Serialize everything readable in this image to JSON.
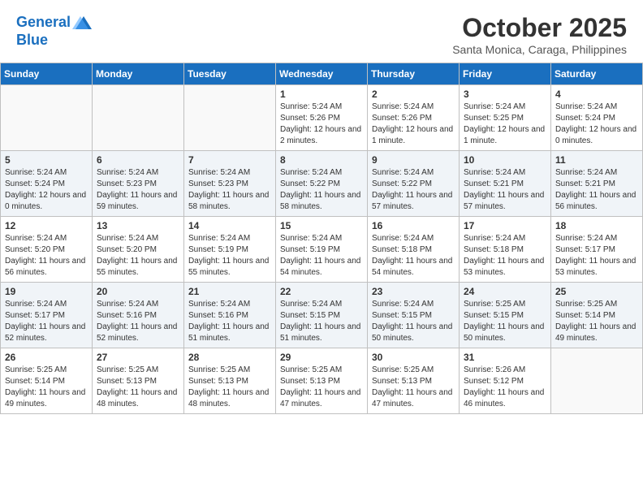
{
  "header": {
    "logo_line1": "General",
    "logo_line2": "Blue",
    "month": "October 2025",
    "location": "Santa Monica, Caraga, Philippines"
  },
  "weekdays": [
    "Sunday",
    "Monday",
    "Tuesday",
    "Wednesday",
    "Thursday",
    "Friday",
    "Saturday"
  ],
  "weeks": [
    [
      {
        "day": "",
        "info": ""
      },
      {
        "day": "",
        "info": ""
      },
      {
        "day": "",
        "info": ""
      },
      {
        "day": "1",
        "info": "Sunrise: 5:24 AM\nSunset: 5:26 PM\nDaylight: 12 hours and 2 minutes."
      },
      {
        "day": "2",
        "info": "Sunrise: 5:24 AM\nSunset: 5:26 PM\nDaylight: 12 hours and 1 minute."
      },
      {
        "day": "3",
        "info": "Sunrise: 5:24 AM\nSunset: 5:25 PM\nDaylight: 12 hours and 1 minute."
      },
      {
        "day": "4",
        "info": "Sunrise: 5:24 AM\nSunset: 5:24 PM\nDaylight: 12 hours and 0 minutes."
      }
    ],
    [
      {
        "day": "5",
        "info": "Sunrise: 5:24 AM\nSunset: 5:24 PM\nDaylight: 12 hours and 0 minutes."
      },
      {
        "day": "6",
        "info": "Sunrise: 5:24 AM\nSunset: 5:23 PM\nDaylight: 11 hours and 59 minutes."
      },
      {
        "day": "7",
        "info": "Sunrise: 5:24 AM\nSunset: 5:23 PM\nDaylight: 11 hours and 58 minutes."
      },
      {
        "day": "8",
        "info": "Sunrise: 5:24 AM\nSunset: 5:22 PM\nDaylight: 11 hours and 58 minutes."
      },
      {
        "day": "9",
        "info": "Sunrise: 5:24 AM\nSunset: 5:22 PM\nDaylight: 11 hours and 57 minutes."
      },
      {
        "day": "10",
        "info": "Sunrise: 5:24 AM\nSunset: 5:21 PM\nDaylight: 11 hours and 57 minutes."
      },
      {
        "day": "11",
        "info": "Sunrise: 5:24 AM\nSunset: 5:21 PM\nDaylight: 11 hours and 56 minutes."
      }
    ],
    [
      {
        "day": "12",
        "info": "Sunrise: 5:24 AM\nSunset: 5:20 PM\nDaylight: 11 hours and 56 minutes."
      },
      {
        "day": "13",
        "info": "Sunrise: 5:24 AM\nSunset: 5:20 PM\nDaylight: 11 hours and 55 minutes."
      },
      {
        "day": "14",
        "info": "Sunrise: 5:24 AM\nSunset: 5:19 PM\nDaylight: 11 hours and 55 minutes."
      },
      {
        "day": "15",
        "info": "Sunrise: 5:24 AM\nSunset: 5:19 PM\nDaylight: 11 hours and 54 minutes."
      },
      {
        "day": "16",
        "info": "Sunrise: 5:24 AM\nSunset: 5:18 PM\nDaylight: 11 hours and 54 minutes."
      },
      {
        "day": "17",
        "info": "Sunrise: 5:24 AM\nSunset: 5:18 PM\nDaylight: 11 hours and 53 minutes."
      },
      {
        "day": "18",
        "info": "Sunrise: 5:24 AM\nSunset: 5:17 PM\nDaylight: 11 hours and 53 minutes."
      }
    ],
    [
      {
        "day": "19",
        "info": "Sunrise: 5:24 AM\nSunset: 5:17 PM\nDaylight: 11 hours and 52 minutes."
      },
      {
        "day": "20",
        "info": "Sunrise: 5:24 AM\nSunset: 5:16 PM\nDaylight: 11 hours and 52 minutes."
      },
      {
        "day": "21",
        "info": "Sunrise: 5:24 AM\nSunset: 5:16 PM\nDaylight: 11 hours and 51 minutes."
      },
      {
        "day": "22",
        "info": "Sunrise: 5:24 AM\nSunset: 5:15 PM\nDaylight: 11 hours and 51 minutes."
      },
      {
        "day": "23",
        "info": "Sunrise: 5:24 AM\nSunset: 5:15 PM\nDaylight: 11 hours and 50 minutes."
      },
      {
        "day": "24",
        "info": "Sunrise: 5:25 AM\nSunset: 5:15 PM\nDaylight: 11 hours and 50 minutes."
      },
      {
        "day": "25",
        "info": "Sunrise: 5:25 AM\nSunset: 5:14 PM\nDaylight: 11 hours and 49 minutes."
      }
    ],
    [
      {
        "day": "26",
        "info": "Sunrise: 5:25 AM\nSunset: 5:14 PM\nDaylight: 11 hours and 49 minutes."
      },
      {
        "day": "27",
        "info": "Sunrise: 5:25 AM\nSunset: 5:13 PM\nDaylight: 11 hours and 48 minutes."
      },
      {
        "day": "28",
        "info": "Sunrise: 5:25 AM\nSunset: 5:13 PM\nDaylight: 11 hours and 48 minutes."
      },
      {
        "day": "29",
        "info": "Sunrise: 5:25 AM\nSunset: 5:13 PM\nDaylight: 11 hours and 47 minutes."
      },
      {
        "day": "30",
        "info": "Sunrise: 5:25 AM\nSunset: 5:13 PM\nDaylight: 11 hours and 47 minutes."
      },
      {
        "day": "31",
        "info": "Sunrise: 5:26 AM\nSunset: 5:12 PM\nDaylight: 11 hours and 46 minutes."
      },
      {
        "day": "",
        "info": ""
      }
    ]
  ]
}
